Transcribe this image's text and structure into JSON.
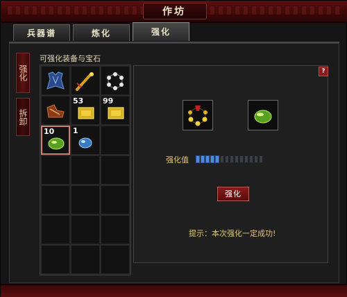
{
  "window": {
    "title": "作坊"
  },
  "tabs": [
    {
      "label": "兵器谱"
    },
    {
      "label": "炼化"
    },
    {
      "label": "强化",
      "active": true
    }
  ],
  "side_tabs": [
    {
      "label": "强化",
      "active": true
    },
    {
      "label": "拆卸"
    }
  ],
  "inventory": {
    "label": "可强化装备与宝石",
    "slots": [
      {
        "icon": "blue-armor-icon",
        "qty": ""
      },
      {
        "icon": "golden-flute-icon",
        "qty": ""
      },
      {
        "icon": "bead-necklace-icon",
        "qty": ""
      },
      {
        "icon": "red-boots-icon",
        "qty": ""
      },
      {
        "icon": "gold-ingot-icon",
        "qty": "53"
      },
      {
        "icon": "gold-ingot-icon",
        "qty": "99"
      },
      {
        "icon": "green-gem-icon",
        "qty": "10",
        "selected": true
      },
      {
        "icon": "blue-gem-icon",
        "qty": "1"
      }
    ]
  },
  "forge": {
    "help": "?",
    "equipment_slot_icon": "bead-necklace-icon",
    "gem_slot_icon": "green-gem-icon",
    "strength_label": "强化值",
    "strength_progress": {
      "filled": 5,
      "total": 14
    },
    "button_label": "强化",
    "hint": "提示：本次强化一定成功!"
  },
  "colors": {
    "accent_red": "#8a1a1a",
    "gold_text": "#e0c67a",
    "progress_blue": "#4f8ad8"
  }
}
